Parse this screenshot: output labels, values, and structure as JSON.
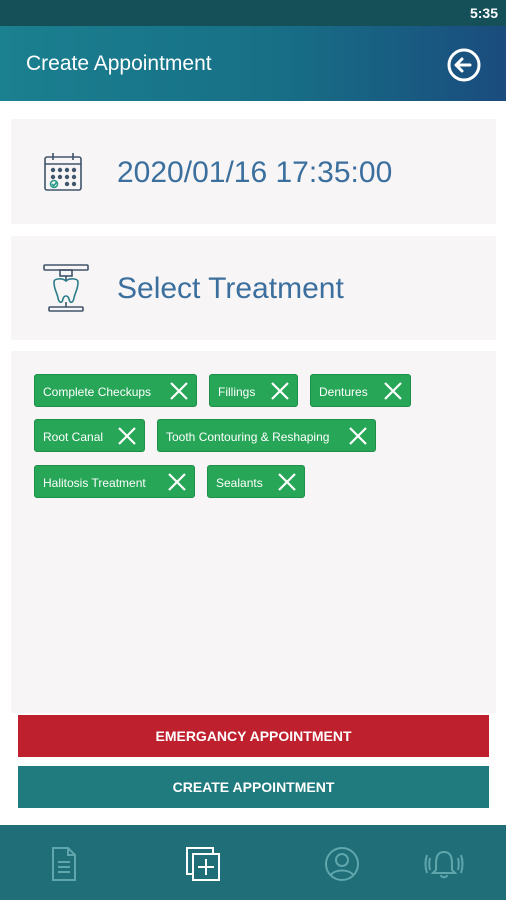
{
  "status_bar": {
    "time": "5:35"
  },
  "app_bar": {
    "title": "Create Appointment",
    "back_icon": "back-arrow-circle-icon"
  },
  "date_card": {
    "icon": "calendar-icon",
    "value": "2020/01/16 17:35:00"
  },
  "treatment_card": {
    "icon": "dental-tooth-icon",
    "label": "Select Treatment"
  },
  "selected_treatments": [
    {
      "label": "Complete Checkups"
    },
    {
      "label": "Fillings"
    },
    {
      "label": "Dentures"
    },
    {
      "label": "Root Canal"
    },
    {
      "label": "Tooth Contouring & Reshaping"
    },
    {
      "label": "Halitosis Treatment"
    },
    {
      "label": "Sealants"
    }
  ],
  "buttons": {
    "emergency": "EMERGANCY APPOINTMENT",
    "create": "CREATE APPOINTMENT"
  },
  "bottom_nav": [
    {
      "icon": "document-icon"
    },
    {
      "icon": "add-copy-icon"
    },
    {
      "icon": "user-profile-icon"
    },
    {
      "icon": "alarm-bell-icon"
    }
  ],
  "colors": {
    "primary_teal": "#1f6e78",
    "chip_green": "#27a657",
    "emergency_red": "#be202d",
    "heading_blue": "#3b6f9e"
  }
}
